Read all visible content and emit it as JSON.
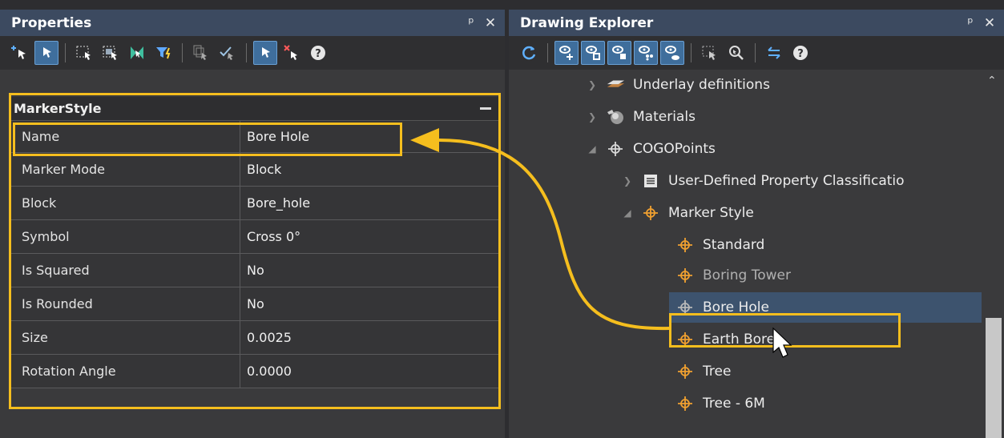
{
  "properties_panel": {
    "title": "Properties",
    "pin_icon": "pin-icon",
    "close_icon": "close-icon",
    "category": "MarkerStyle",
    "rows": [
      {
        "name": "Name",
        "value": "Bore Hole"
      },
      {
        "name": "Marker Mode",
        "value": "Block"
      },
      {
        "name": "Block",
        "value": "Bore_hole"
      },
      {
        "name": "Symbol",
        "value": "Cross 0°"
      },
      {
        "name": "Is Squared",
        "value": "No"
      },
      {
        "name": "Is Rounded",
        "value": "No"
      },
      {
        "name": "Size",
        "value": "0.0025"
      },
      {
        "name": "Rotation Angle",
        "value": "0.0000"
      }
    ]
  },
  "explorer_panel": {
    "title": "Drawing Explorer",
    "pin_icon": "pin-icon",
    "close_icon": "close-icon",
    "tree": [
      {
        "label": "Underlay definitions",
        "icon": "layers-icon"
      },
      {
        "label": "Materials",
        "icon": "materials-icon"
      },
      {
        "label": "COGOPoints",
        "icon": "crosshair-icon"
      },
      {
        "label": "User-Defined Property Classificatio",
        "icon": "list-icon"
      },
      {
        "label": "Marker Style",
        "icon": "crosshair-icon"
      },
      {
        "label": "Standard",
        "icon": "crosshair-icon"
      },
      {
        "label": "Boring Tower",
        "icon": "crosshair-icon"
      },
      {
        "label": "Bore Hole",
        "icon": "crosshair-icon",
        "selected": true
      },
      {
        "label": "Earth Bore",
        "icon": "crosshair-icon"
      },
      {
        "label": "Tree",
        "icon": "crosshair-icon"
      },
      {
        "label": "Tree - 6M",
        "icon": "crosshair-icon"
      }
    ]
  },
  "colors": {
    "highlight": "#f5be1e",
    "titlebar": "#3c4a60",
    "selection": "#3d536e",
    "marker_icon": "#f0a030"
  }
}
